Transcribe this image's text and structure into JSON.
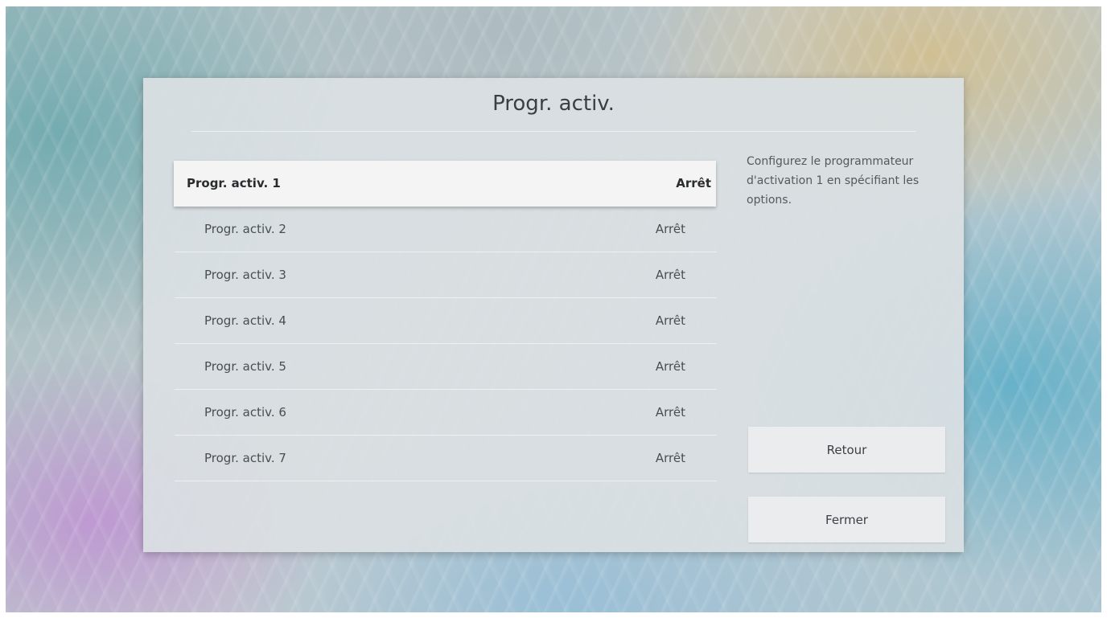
{
  "dialog": {
    "title": "Progr. activ.",
    "description": "Configurez le programmateur d'activation 1 en spécifiant les options."
  },
  "timers": [
    {
      "label": "Progr. activ. 1",
      "value": "Arrêt",
      "selected": true
    },
    {
      "label": "Progr. activ. 2",
      "value": "Arrêt"
    },
    {
      "label": "Progr. activ. 3",
      "value": "Arrêt"
    },
    {
      "label": "Progr. activ. 4",
      "value": "Arrêt"
    },
    {
      "label": "Progr. activ. 5",
      "value": "Arrêt"
    },
    {
      "label": "Progr. activ. 6",
      "value": "Arrêt"
    },
    {
      "label": "Progr. activ. 7",
      "value": "Arrêt"
    }
  ],
  "buttons": {
    "back_label": "Retour",
    "close_label": "Fermer"
  }
}
